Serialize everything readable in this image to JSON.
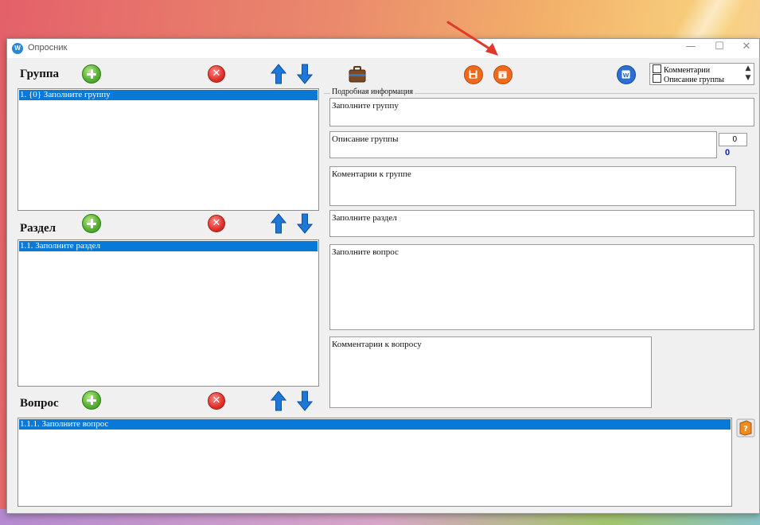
{
  "window": {
    "title": "Опросник",
    "app_icon_glyph": "W",
    "controls": {
      "minimize": "—",
      "maximize": "☐",
      "close": "✕"
    }
  },
  "group_section": {
    "label": "Группа",
    "items": [
      "1. {0} Заполните группу"
    ]
  },
  "section_section": {
    "label": "Раздел",
    "items": [
      "1.1. Заполните раздел"
    ]
  },
  "question_section": {
    "label": "Вопрос",
    "items": [
      "1.1.1. Заполните вопрос"
    ]
  },
  "options_panel": {
    "items": [
      {
        "label": "Комментарии",
        "checked": false
      },
      {
        "label": "Описание группы",
        "checked": false
      }
    ]
  },
  "details": {
    "title": "Подробная информация",
    "group_name": "Заполните группу",
    "group_description": "Описание группы",
    "group_comment": "Коментарии к группе",
    "section_name": "Заполните раздел",
    "question_text": "Заполните вопрос",
    "question_comment": "Комментарии к вопросу",
    "counter_input": "0",
    "counter_label": "0"
  },
  "icons": {
    "add": "add-icon",
    "delete": "delete-icon",
    "move_up": "arrow-up-icon",
    "move_down": "arrow-down-icon",
    "briefcase": "briefcase-icon",
    "save": "save-icon",
    "export": "export-icon",
    "word": "word-icon",
    "help": "help-book-icon"
  },
  "colors": {
    "selection": "#0a78d7",
    "add_green": "#58b233",
    "delete_red": "#e0302a",
    "arrow_blue": "#1e78d8",
    "orange_button": "#f06a1d",
    "word_blue": "#2b6fd1",
    "annotation_red": "#e2372b"
  }
}
